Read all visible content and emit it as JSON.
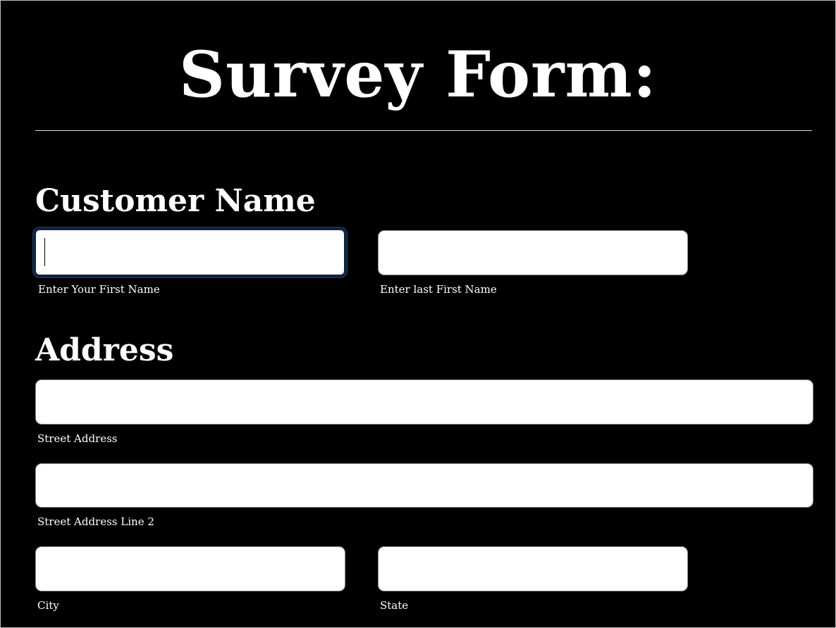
{
  "form": {
    "title": "Survey Form:",
    "sections": {
      "customer_name": {
        "heading": "Customer Name",
        "first_name": {
          "value": "",
          "hint": "Enter Your First Name"
        },
        "last_name": {
          "value": "",
          "hint": "Enter last First Name"
        }
      },
      "address": {
        "heading": "Address",
        "street": {
          "value": "",
          "hint": "Street Address"
        },
        "street2": {
          "value": "",
          "hint": "Street Address Line 2"
        },
        "city": {
          "value": "",
          "hint": "City"
        },
        "state": {
          "value": "",
          "hint": "State"
        }
      }
    }
  },
  "colors": {
    "background": "#000000",
    "text": "#ffffff",
    "input_background": "#ffffff",
    "focus_ring": "#10223d"
  }
}
